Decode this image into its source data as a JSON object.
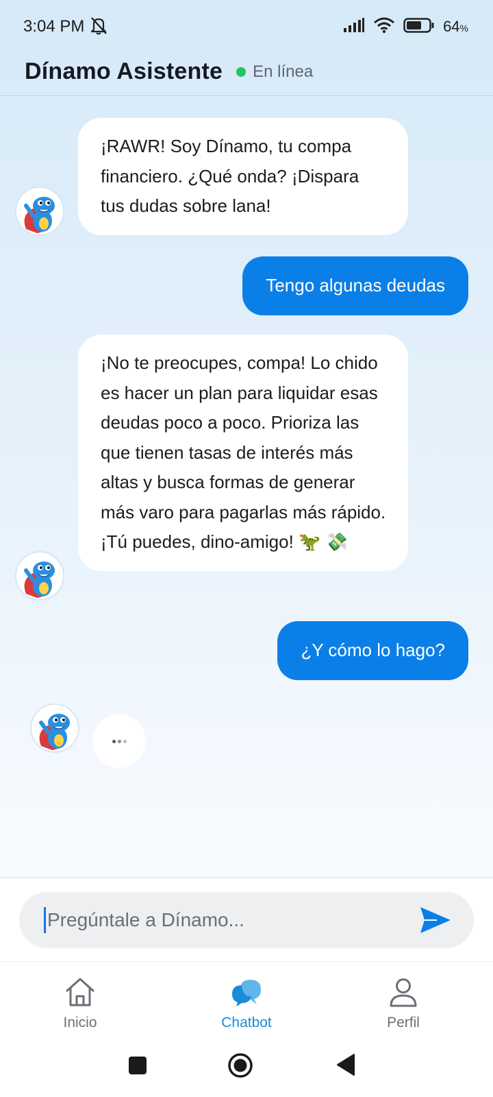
{
  "status_bar": {
    "time": "3:04 PM",
    "battery_percent": "64",
    "battery_unit": "%",
    "icons": [
      "notifications-off-icon",
      "signal-icon",
      "wifi-icon",
      "battery-icon"
    ]
  },
  "header": {
    "title": "Dínamo Asistente",
    "status": "En línea",
    "status_color": "#22c55e"
  },
  "messages": [
    {
      "sender": "bot",
      "text": "¡RAWR! Soy Dínamo, tu compa financiero. ¿Qué onda? ¡Dispara tus dudas sobre lana!"
    },
    {
      "sender": "user",
      "text": "Tengo algunas deudas"
    },
    {
      "sender": "bot",
      "text": "¡No te preocupes, compa! Lo chido es hacer un plan para liquidar esas deudas poco a poco. Prioriza las que tienen tasas de interés más altas y busca formas de generar más varo para pagarlas más rápido. ¡Tú puedes, dino-amigo! 🦖 💸"
    },
    {
      "sender": "user",
      "text": "¿Y cómo lo hago?"
    }
  ],
  "typing_indicator": {
    "icon": "typing-dots-icon"
  },
  "input": {
    "placeholder": "Pregúntale a Dínamo...",
    "value": ""
  },
  "nav": {
    "items": [
      {
        "label": "Inicio",
        "icon": "home-icon"
      },
      {
        "label": "Chatbot",
        "icon": "chat-bubbles-icon",
        "active": true
      },
      {
        "label": "Perfil",
        "icon": "user-icon"
      }
    ]
  },
  "colors": {
    "accent": "#0b7fe8",
    "nav_active": "#1a8bd8"
  }
}
